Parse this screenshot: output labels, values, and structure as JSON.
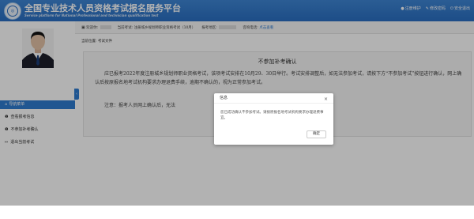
{
  "header": {
    "title": "全国专业技术人员资格考试报名服务平台",
    "subtitle": "Service platform for National Professional and technician qualification test",
    "links": [
      {
        "icon": "user-icon",
        "label": "注册维护"
      },
      {
        "icon": "edit-icon",
        "label": "修改密码"
      },
      {
        "icon": "power-icon",
        "label": "安全退出"
      }
    ]
  },
  "infobar": {
    "welcome_label": "欢迎你:",
    "exam_label": "当前考试: 注册城乡规划师职业资格考试（10月）",
    "region_label": "报考地区:",
    "phone_label": "咨询电话:",
    "phone_link": "点击查看"
  },
  "sidebar": {
    "nav_title": "导航菜单",
    "items": [
      {
        "icon": "info-icon",
        "label": "查看报考信息"
      },
      {
        "icon": "info-icon",
        "label": "不参加补考确认"
      },
      {
        "icon": "exit-icon",
        "label": "退出当前考试"
      }
    ]
  },
  "main": {
    "breadcrumb": "当前位置: 考试文件",
    "notice_title": "不参加补考确认",
    "notice_body": "应已报考2022年度注册城乡规划师职业资格考试，该项考试安排在10月29、30日举行。考试安排调整后，如无法参加考试，请按下方“不参加考试”按钮进行确认，网上确认后按原报名地考试机构要求办理退费手续，逾期不确认的，视为正常参加考试。",
    "notice_note": "注意：报考人员网上确认后，无法"
  },
  "dialog": {
    "title": "信息",
    "close": "×",
    "message": "您已成功确认不参加考试。请按原报名地考试机构要求办理退费事宜。",
    "ok_label": "确定"
  },
  "colors": {
    "header_blue": "#2a6ec2",
    "nav_blue": "#2f7bd0",
    "overlay": "rgba(0,0,0,0.30)"
  }
}
